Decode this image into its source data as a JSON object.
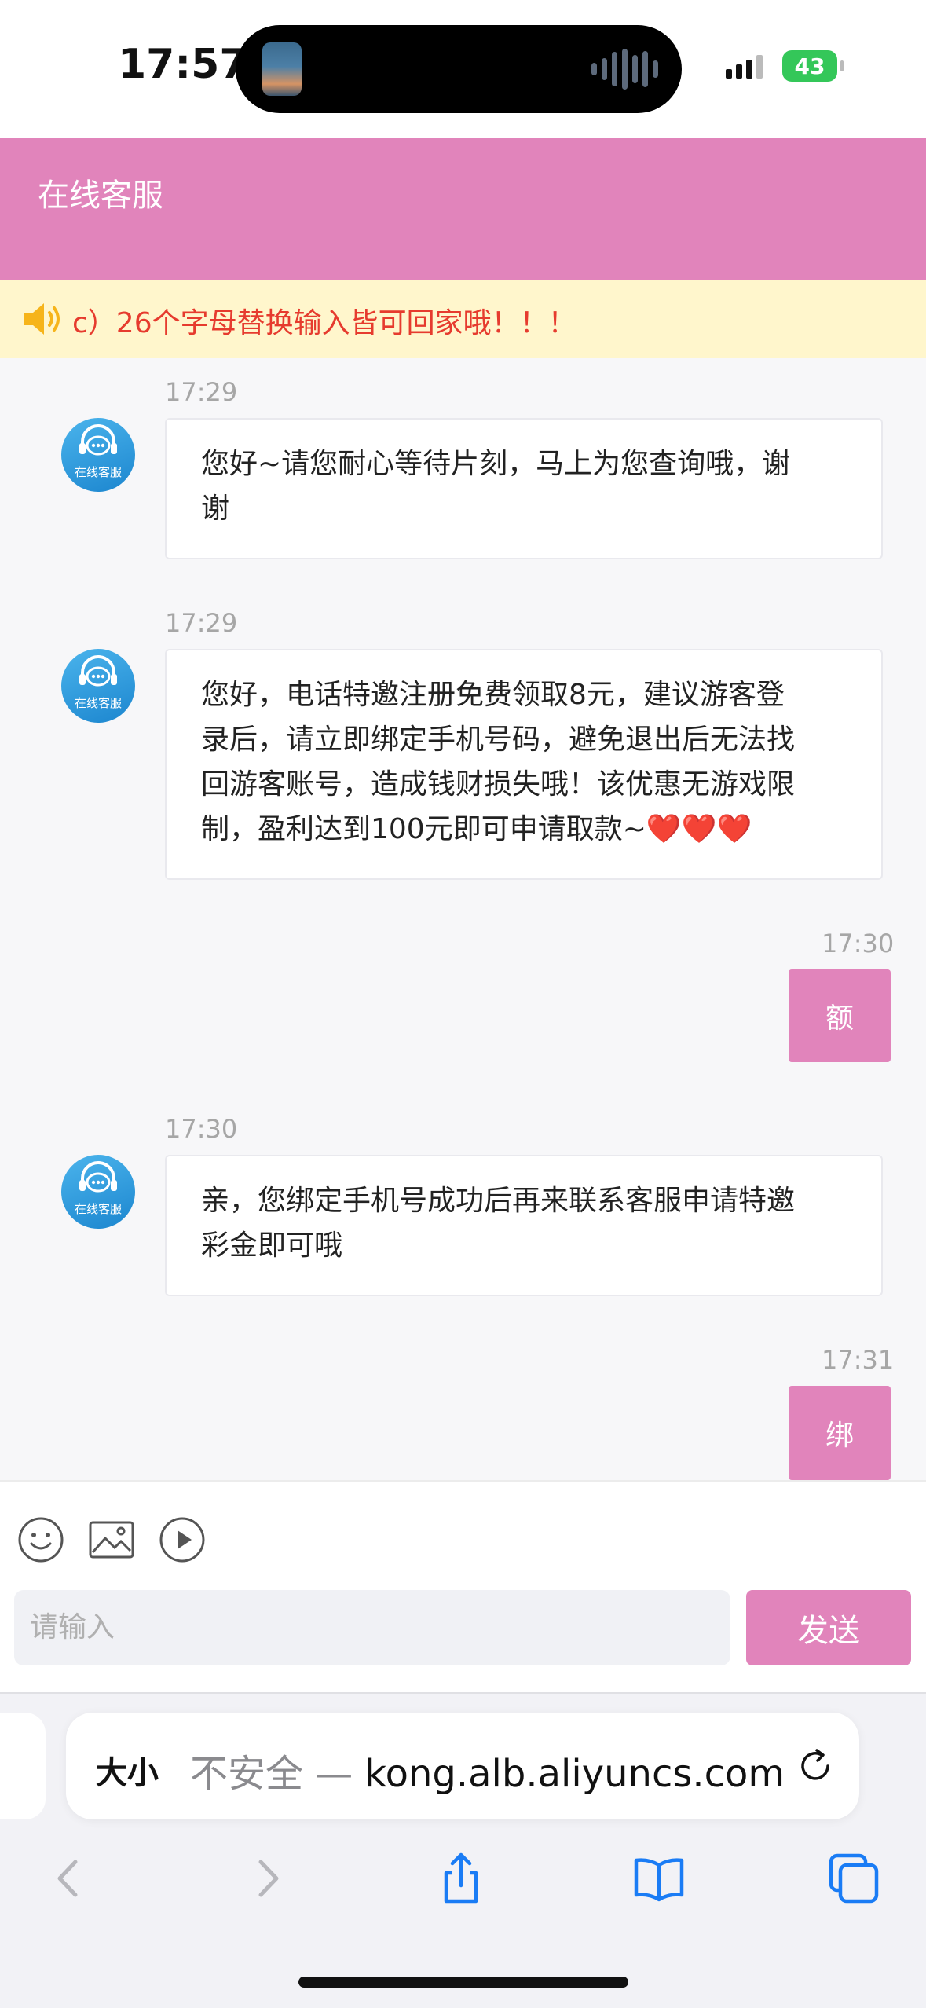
{
  "status": {
    "time": "17:57",
    "battery": "43"
  },
  "header": {
    "title": "在线客服"
  },
  "notice": {
    "text": "c）26个字母替换输入皆可回家哦！！！"
  },
  "messages": [
    {
      "time": "17:29",
      "from": "agent",
      "avatar_label": "在线客服",
      "lines": [
        "您好~请您耐心等待片刻，马上为您查询哦，谢",
        "谢"
      ]
    },
    {
      "time": "17:29",
      "from": "agent",
      "avatar_label": "在线客服",
      "lines": [
        "您好，电话特邀注册免费领取8元，建议游客登",
        "录后，请立即绑定手机号码，避免退出后无法找",
        "回游客账号，造成钱财损失哦！该优惠无游戏限",
        "制，盈利达到100元即可申请取款~"
      ],
      "emoji": "❤️❤️❤️"
    },
    {
      "time": "17:30",
      "from": "user",
      "text": "额"
    },
    {
      "time": "17:30",
      "from": "agent",
      "avatar_label": "在线客服",
      "lines": [
        "亲，您绑定手机号成功后再来联系客服申请特邀",
        "彩金即可哦"
      ]
    },
    {
      "time": "17:31",
      "from": "user",
      "text": "绑"
    }
  ],
  "composer": {
    "placeholder": "请输入",
    "send_label": "发送"
  },
  "browser": {
    "text_size_label": "大小",
    "insecure_label": "不安全 — ",
    "url": "kong.alb.aliyuncs.com"
  },
  "colors": {
    "brand_pink": "#e184bb",
    "notice_bg": "#fff6cc",
    "notice_text": "#e63b2e",
    "ios_blue": "#1a7cf5"
  }
}
